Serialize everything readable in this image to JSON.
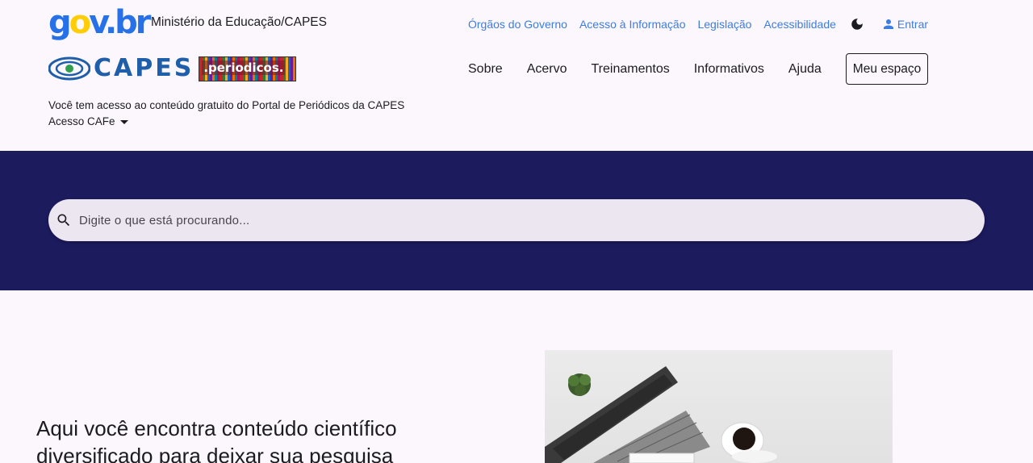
{
  "header": {
    "govbr_logo": "gov.br",
    "ministry": "Ministério da Educação/CAPES",
    "util_links": [
      "Órgãos do Governo",
      "Acesso à Informação",
      "Legislação",
      "Acessibilidade"
    ],
    "login_label": "Entrar",
    "capes_logo_text": "CAPES",
    "periodicos_logo_text": ".periodicos.",
    "nav": [
      "Sobre",
      "Acervo",
      "Treinamentos",
      "Informativos",
      "Ajuda"
    ],
    "meu_espaco_label": "Meu espaço",
    "access_message": "Você tem acesso ao conteúdo gratuito do Portal de Periódicos da CAPES",
    "cafe_label": "Acesso CAFe"
  },
  "search": {
    "placeholder": "Digite o que está procurando..."
  },
  "hero": {
    "text": "Aqui você encontra conteúdo científico diversificado para deixar sua pesquisa"
  },
  "icons": {
    "theme": "moon-icon",
    "login": "person-icon",
    "search": "search-icon",
    "cafe": "caret-down-icon"
  },
  "colors": {
    "band": "#1c1b5e",
    "link": "#3c7de0",
    "background": "#fcf7fd",
    "search_bg": "#ece6f0"
  }
}
